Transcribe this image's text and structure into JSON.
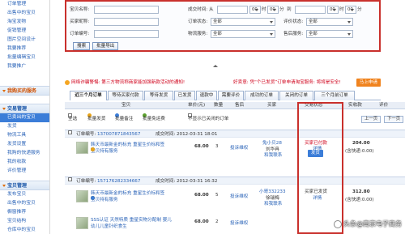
{
  "sidebar": {
    "top_items": [
      "订单管理",
      "出售中的宝贝",
      "淘宝发物",
      "促销管理",
      "图片空间设计",
      "我要推荐",
      "批量编辑宝贝",
      "我要推广"
    ],
    "section_buyer": "我购买的服务",
    "section_trade": "交易管理",
    "trade_items": [
      "已卖出的宝贝",
      "发货",
      "物流工具",
      "发货设置",
      "我购的快递服务",
      "我的收款",
      "评价管理"
    ],
    "section_baby": "宝贝管理",
    "baby_items": [
      "发布宝贝",
      "出售中的宝贝",
      "橱窗推荐",
      "宝贝结构",
      "仓库中的宝贝"
    ]
  },
  "search": {
    "title_label": "宝贝名称:",
    "buyer_label": "买家昵称:",
    "order_no_label": "订单编号:",
    "time_label": "成交时间: 从",
    "hour1": "00",
    "min1": "00",
    "to_label": "到",
    "hour2": "00",
    "min2": "00",
    "order_status_label": "订单状态:",
    "order_status_value": "全部",
    "rate_status_label": "评价状态:",
    "rate_status_value": "全部",
    "logistics_label": "物流服务:",
    "logistics_value": "全部",
    "aftersale_label": "售后服务:",
    "aftersale_value": "全部",
    "search_button": "搜索",
    "export_button": "批量导出"
  },
  "notice": {
    "text": "网络诈骗警惕: 第三方物流称商家能加强新款活动的通知!",
    "text2": "好卖意: 凭“个已发货”订单申请淘宝服务: 将将是安全!",
    "button": "马上申请"
  },
  "tabs": [
    "近三个月订单",
    "等待买家付款",
    "等待发货",
    "已发货",
    "退款中",
    "需要评价",
    "成功的订单",
    "关闭的订单",
    "三个月前订单"
  ],
  "columns": {
    "item": "宝贝",
    "price": "单价(元)",
    "qty": "数量",
    "aftersale": "售后",
    "buyer": "买家",
    "status": "交易状态",
    "amount": "实收款",
    "rate": "评价"
  },
  "toolbar": {
    "select_all": "全选",
    "batch_ship": "批量发货",
    "batch_remark": "批量备注",
    "batch_free": "批量免运费",
    "hide_closed": "不显示已关闭的订单",
    "prev": "上一页",
    "next": "下一页"
  },
  "orders": [
    {
      "order_label": "订单编号:",
      "order_no": "137007871843567",
      "time_label": "成交时间:",
      "time": "2012-03-31 18:01",
      "title": "韩天币最新金的标充 重星生价标和签",
      "title2": "宝贝持有服务",
      "price": "68.00",
      "qty": "3",
      "aftersale": "投诉维权",
      "buyer": "兔小贝28",
      "buyer2": "刘华冉",
      "buyer3": "和我联系",
      "status": "买家已付款",
      "status2": "详情",
      "ship_button": "发货",
      "amount": "204.00",
      "amount_note": "(含快递:0.00)"
    },
    {
      "order_label": "订单编号:",
      "order_no": "157176282334667",
      "time_label": "成交时间:",
      "time": "2012-03-31 16:32",
      "title": "韩天币最新金的标充 重星生价标和签",
      "title2": "宝贝持有服务",
      "price": "68.00",
      "qty": "5",
      "aftersale": "投诉维权",
      "buyer": "小哥332233",
      "buyer2": "徐瑞梅",
      "buyer3": "和我联系",
      "status": "买家已发货",
      "status2": "详情",
      "amount": "312.80",
      "amount_note": "(含快递:0.00)"
    },
    {
      "title": "SSS认证 天然特质 重星实物分配制 婴儿",
      "title2": "幼儿儿童针织食生",
      "price": "68.00",
      "qty": "2",
      "aftersale": "投诉维权"
    }
  ],
  "watermark": "头条@南京电子商务"
}
